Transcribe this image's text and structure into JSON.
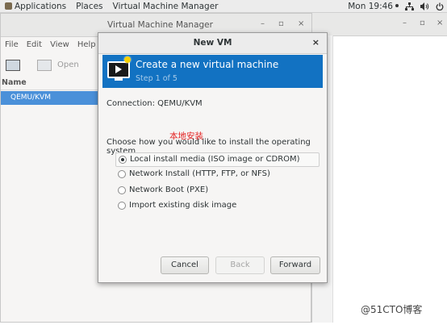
{
  "topbar": {
    "applications": "Applications",
    "places": "Places",
    "app_name": "Virtual Machine Manager",
    "clock": "Mon 19:46"
  },
  "main_window": {
    "title": "Virtual Machine Manager",
    "menu": [
      "File",
      "Edit",
      "View",
      "Help"
    ],
    "toolbar_open": "Open",
    "list_header": "Name",
    "connection_row": "QEMU/KVM"
  },
  "dialog": {
    "title": "New VM",
    "banner_title": "Create a new virtual machine",
    "banner_step": "Step 1 of 5",
    "connection_label": "Connection:",
    "connection_value": "QEMU/KVM",
    "annotation": "本地安装",
    "choose_label": "Choose how you would like to install the operating system",
    "options": [
      {
        "label": "Local install media (ISO image or CDROM)",
        "selected": true
      },
      {
        "label": "Network Install (HTTP, FTP, or NFS)",
        "selected": false
      },
      {
        "label": "Network Boot (PXE)",
        "selected": false
      },
      {
        "label": "Import existing disk image",
        "selected": false
      }
    ],
    "buttons": {
      "cancel": "Cancel",
      "back": "Back",
      "forward": "Forward"
    }
  },
  "watermark": "@51CTO博客",
  "colors": {
    "banner": "#1272c2",
    "selection": "#4a90d9",
    "annotation": "#e32020"
  }
}
